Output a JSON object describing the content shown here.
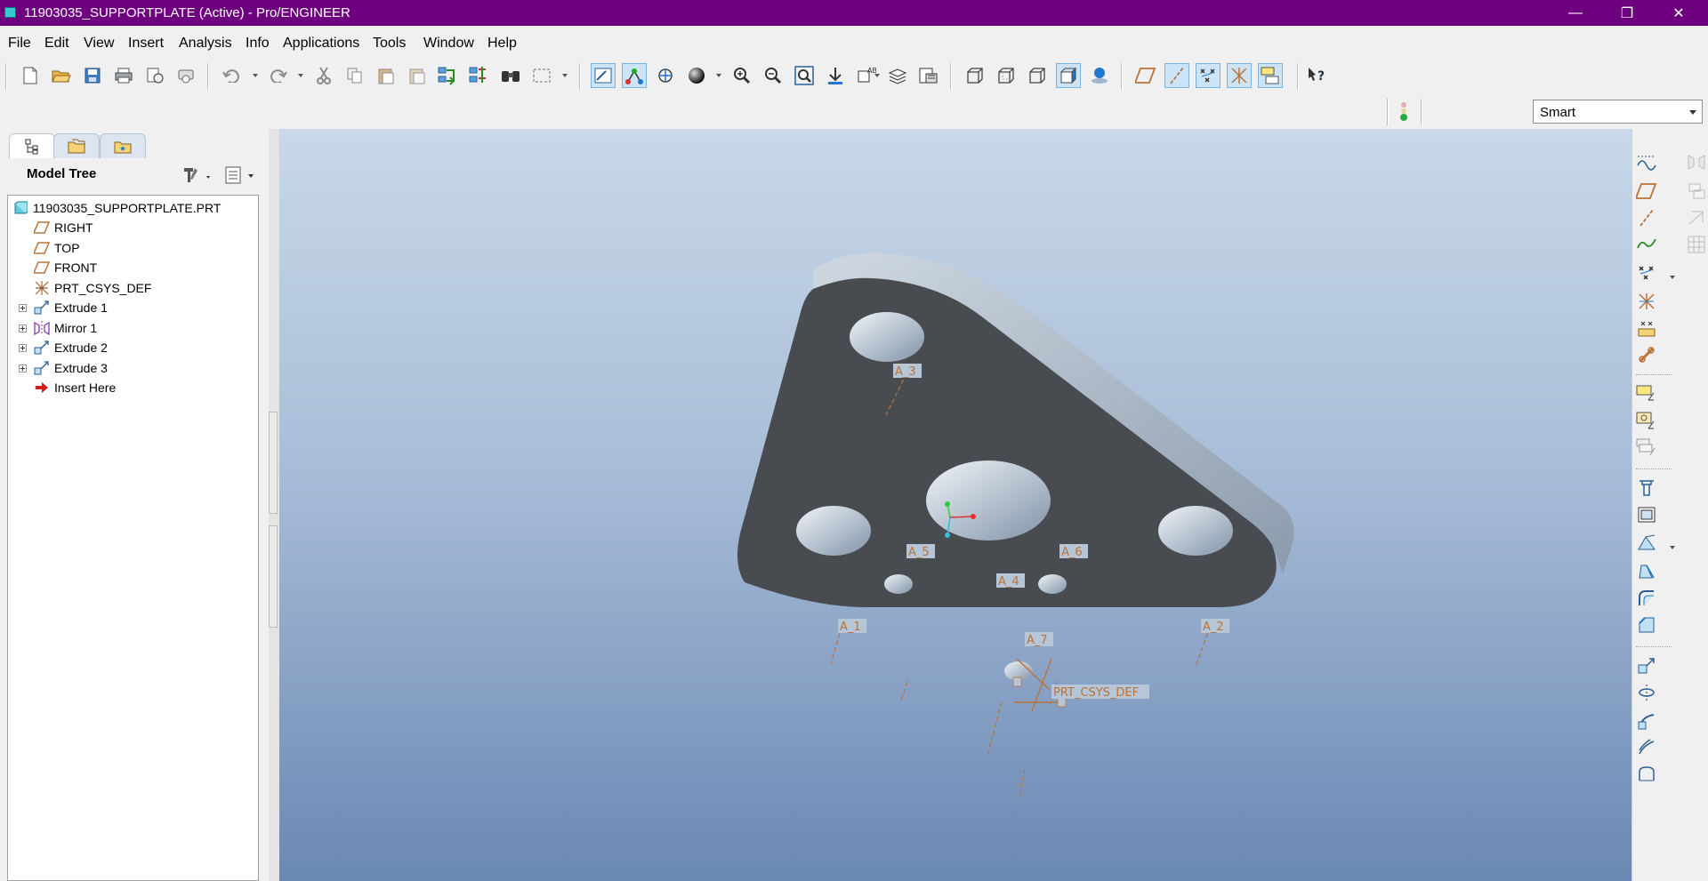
{
  "window": {
    "title": "11903035_SUPPORTPLATE (Active) - Pro/ENGINEER",
    "controls": {
      "minimize": "—",
      "restore": "❐",
      "close": "✕"
    }
  },
  "menu": [
    "File",
    "Edit",
    "View",
    "Insert",
    "Analysis",
    "Info",
    "Applications",
    "Tools",
    "Window",
    "Help"
  ],
  "filter": {
    "selected": "Smart"
  },
  "model_tree": {
    "title": "Model Tree",
    "items": [
      {
        "label": "11903035_SUPPORTPLATE.PRT",
        "icon": "part-icon",
        "expandable": false
      },
      {
        "label": "RIGHT",
        "icon": "datum-plane-icon",
        "expandable": false
      },
      {
        "label": "TOP",
        "icon": "datum-plane-icon",
        "expandable": false
      },
      {
        "label": "FRONT",
        "icon": "datum-plane-icon",
        "expandable": false
      },
      {
        "label": "PRT_CSYS_DEF",
        "icon": "csys-icon",
        "expandable": false
      },
      {
        "label": "Extrude 1",
        "icon": "extrude-icon",
        "expandable": true
      },
      {
        "label": "Mirror 1",
        "icon": "mirror-icon",
        "expandable": true
      },
      {
        "label": "Extrude 2",
        "icon": "extrude-icon",
        "expandable": true
      },
      {
        "label": "Extrude 3",
        "icon": "extrude-icon",
        "expandable": true
      },
      {
        "label": "Insert Here",
        "icon": "insert-here-arrow-icon",
        "expandable": false
      }
    ]
  },
  "viewport": {
    "axis_labels": [
      "A_3",
      "A_5",
      "A_6",
      "A_4",
      "A_1",
      "A_2",
      "A_7"
    ],
    "csys_label": "PRT_CSYS_DEF",
    "colors": {
      "plate_face": "#484b50",
      "plate_side": "#b5c2cf",
      "datum": "#b8733a"
    }
  }
}
